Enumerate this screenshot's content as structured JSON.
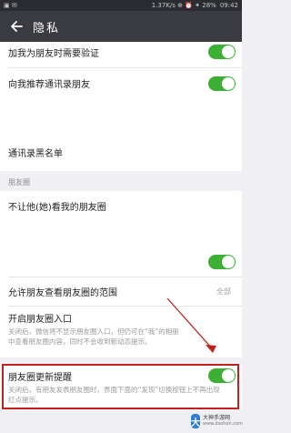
{
  "status_bar": {
    "left_icons": "▣ ✉",
    "right_text": "1.37K/s ⊕ ⏰ ✦ 28%",
    "time": "09:42"
  },
  "app_bar": {
    "title": "隐私"
  },
  "rows": {
    "verify_friend": {
      "label": "加我为朋友时需要验证",
      "toggle_on": true
    },
    "recommend_contacts": {
      "label": "向我推荐通讯录朋友",
      "toggle_on": true
    },
    "blacklist": {
      "label": "通讯录黑名单"
    }
  },
  "moments_section": {
    "header": "朋友圈"
  },
  "moments_rows": {
    "hide_from": {
      "label": "不让他(她)看我的朋友圈"
    },
    "toggle_only": {
      "toggle_on": true
    },
    "visible_range": {
      "label": "允许朋友查看朋友圈的范围",
      "value": "全部"
    },
    "entrance": {
      "label": "开启朋友圈入口",
      "desc": "关闭后，微信将不显示朋友圈入口，但仍可在“我”的相册中查看朋友圈内容，同时不会收到新动态提示。"
    },
    "update_reminder": {
      "label": "朋友圈更新提醒",
      "toggle_on": true,
      "desc": "关闭后，有朋友发表朋友圈时，界面下面的“发现”切换按钮上不再出现红点提示。"
    }
  },
  "watermark": {
    "logo": "大",
    "title": "大神手游网",
    "sub": "www.dashen.com"
  },
  "colors": {
    "toggle_on": "#3cb035",
    "highlight": "#c0221f",
    "app_bar": "#3a3b40"
  }
}
